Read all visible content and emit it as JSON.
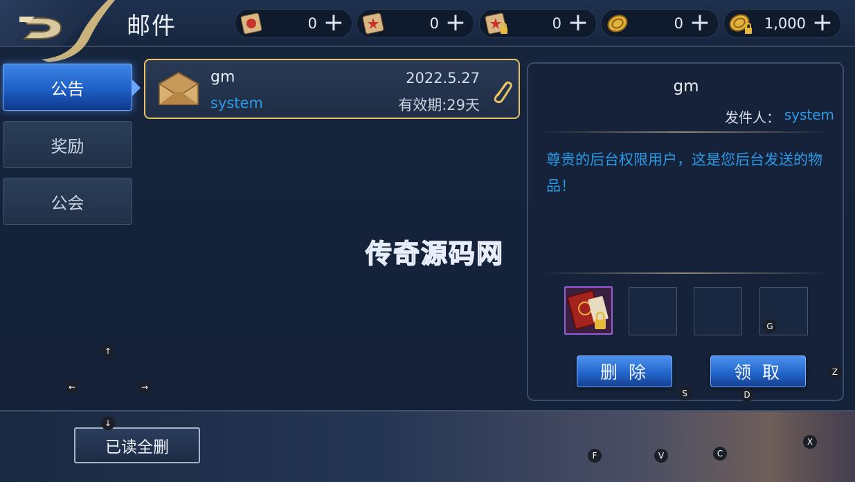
{
  "header": {
    "title": "邮件",
    "currencies": [
      {
        "icon": "red-scroll-icon",
        "value": "0"
      },
      {
        "icon": "star-scroll-icon",
        "value": "0"
      },
      {
        "icon": "locked-scroll-icon",
        "value": "0"
      },
      {
        "icon": "gold-coin-icon",
        "value": "0"
      },
      {
        "icon": "locked-gold-coin-icon",
        "value": "1,000"
      }
    ],
    "plus_symbol": "+"
  },
  "tabs": [
    {
      "label": "公告",
      "active": true
    },
    {
      "label": "奖励",
      "active": false
    },
    {
      "label": "公会",
      "active": false
    }
  ],
  "mail_list": [
    {
      "sender_name": "gm",
      "sender_id": "system",
      "date": "2022.5.27",
      "validity": "有效期:29天",
      "has_attachment": true
    }
  ],
  "detail": {
    "title": "gm",
    "from_label": "发件人：",
    "from_value": "system",
    "body": "尊贵的后台权限用户，这是您后台发送的物品！",
    "attachments": [
      {
        "icon": "red-book-locked-icon",
        "filled": true
      },
      {
        "filled": false
      },
      {
        "filled": false
      },
      {
        "filled": false,
        "key": "G"
      }
    ],
    "delete_label": "删 除",
    "claim_label": "领 取"
  },
  "footer": {
    "delete_read_label": "已读全删"
  },
  "key_hints": {
    "up": "↑",
    "left": "←",
    "right": "→",
    "down": "↓",
    "s": "S",
    "d": "D",
    "z": "Z",
    "f": "F",
    "v": "V",
    "c": "C",
    "x": "X",
    "g": "G"
  },
  "watermark": "传奇源码网",
  "colors": {
    "accent_blue": "#2a8fe0",
    "gold_border": "#e9c467"
  }
}
